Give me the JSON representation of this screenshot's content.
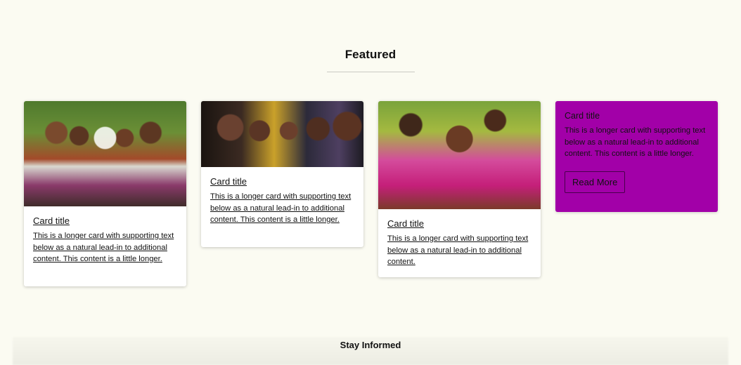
{
  "section": {
    "title": "Featured"
  },
  "cards": [
    {
      "title": "Card title",
      "text": "This is a longer card with supporting text below as a natural lead-in to additional content. This content is a little longer."
    },
    {
      "title": "Card title",
      "text": "This is a longer card with supporting text below as a natural lead-in to additional content. This content is a little longer."
    },
    {
      "title": "Card title",
      "text": "This is a longer card with supporting text below as a natural lead-in to additional content."
    },
    {
      "title": "Card title",
      "text": "This is a longer card with supporting text below as a natural lead-in to additional content. This content is a little longer.",
      "button": "Read More",
      "color": "#a200a8"
    }
  ],
  "footer": {
    "title": "Stay Informed"
  }
}
